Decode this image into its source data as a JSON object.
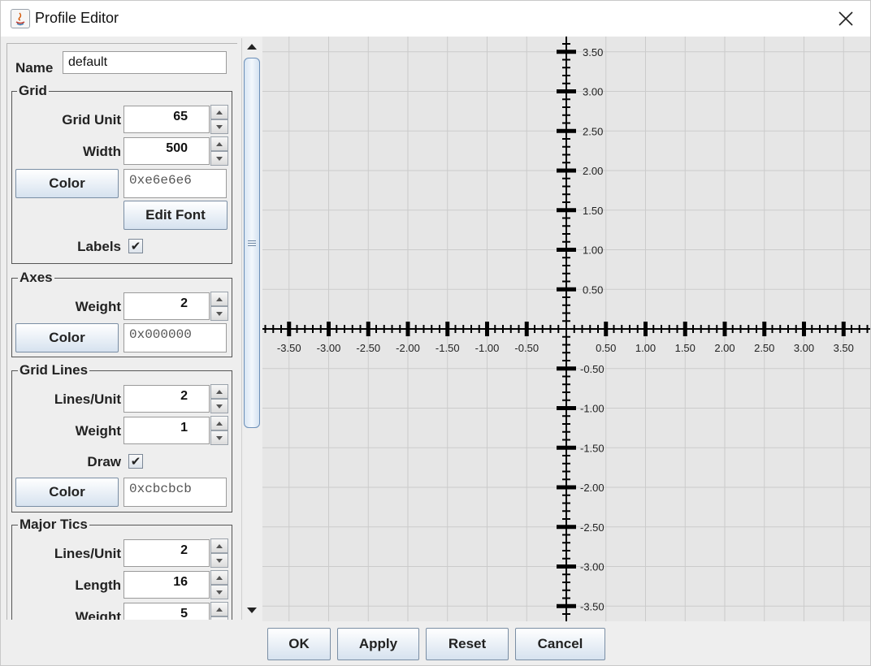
{
  "window": {
    "title": "Profile Editor"
  },
  "name_field": {
    "label": "Name",
    "value": "default"
  },
  "grid": {
    "title": "Grid",
    "grid_unit_label": "Grid Unit",
    "grid_unit": "65",
    "width_label": "Width",
    "width": "500",
    "color_button": "Color",
    "color_value": "0xe6e6e6",
    "edit_font_button": "Edit Font",
    "labels_label": "Labels",
    "labels_checked": "✔"
  },
  "axes": {
    "title": "Axes",
    "weight_label": "Weight",
    "weight": "2",
    "color_button": "Color",
    "color_value": "0x000000"
  },
  "grid_lines": {
    "title": "Grid Lines",
    "lines_unit_label": "Lines/Unit",
    "lines_unit": "2",
    "weight_label": "Weight",
    "weight": "1",
    "draw_label": "Draw",
    "draw_checked": "✔",
    "color_button": "Color",
    "color_value": "0xcbcbcb"
  },
  "major_tics": {
    "title": "Major Tics",
    "lines_unit_label": "Lines/Unit",
    "lines_unit": "2",
    "length_label": "Length",
    "length": "16",
    "weight_label": "Weight",
    "weight": "5"
  },
  "buttons": {
    "ok": "OK",
    "apply": "Apply",
    "reset": "Reset",
    "cancel": "Cancel"
  },
  "colors": {
    "grid_bg": "#e6e6e6",
    "grid_line": "#cbcbcb",
    "axis": "#000000"
  },
  "plot": {
    "x_tick_labels": [
      "-3.50",
      "-3.00",
      "-2.50",
      "-2.00",
      "-1.50",
      "-1.00",
      "-0.50",
      "0.50",
      "1.00",
      "1.50",
      "2.00",
      "2.50",
      "3.00",
      "3.50"
    ],
    "y_tick_labels": [
      "3.50",
      "3.00",
      "2.50",
      "2.00",
      "1.50",
      "1.00",
      "0.50",
      "-0.50",
      "-1.00",
      "-1.50",
      "-2.00",
      "-2.50",
      "-3.00",
      "-3.50"
    ],
    "x_values": [
      -3.5,
      -3.0,
      -2.5,
      -2.0,
      -1.5,
      -1.0,
      -0.5,
      0.5,
      1.0,
      1.5,
      2.0,
      2.5,
      3.0,
      3.5
    ],
    "y_values": [
      3.5,
      3.0,
      2.5,
      2.0,
      1.5,
      1.0,
      0.5,
      -0.5,
      -1.0,
      -1.5,
      -2.0,
      -2.5,
      -3.0,
      -3.5
    ]
  }
}
